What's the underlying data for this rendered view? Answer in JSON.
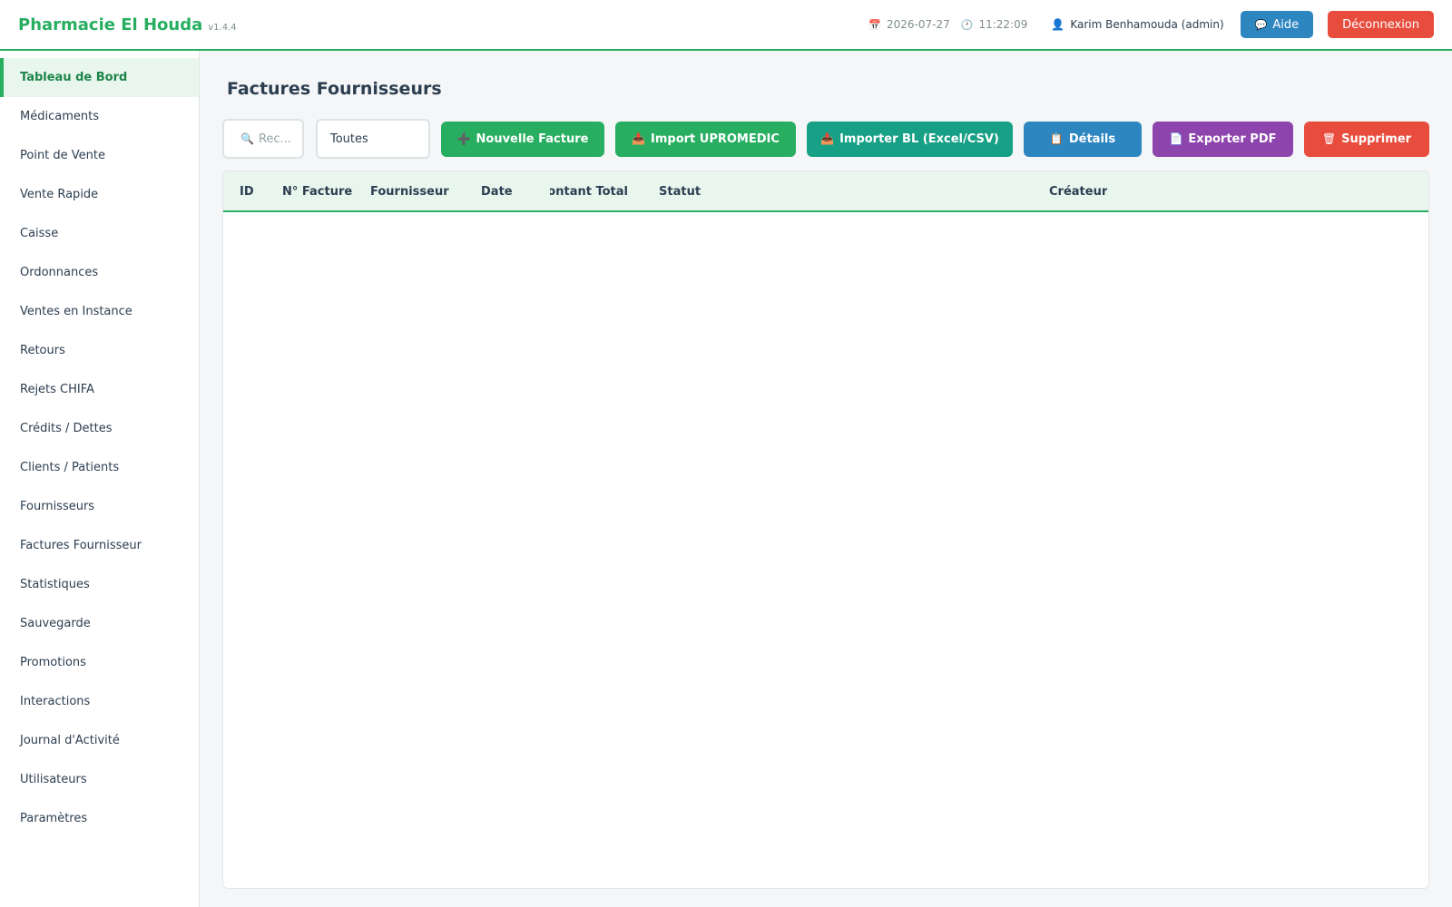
{
  "header": {
    "app_name": "Pharmacie El Houda",
    "version": "v1.4.4",
    "date": "2026-07-27",
    "time": "11:22:09",
    "user": "Karim Benhamouda (admin)",
    "help_label": "Aide",
    "logout_label": "Déconnexion"
  },
  "sidebar": {
    "items": [
      {
        "label": "Tableau de Bord"
      },
      {
        "label": "Médicaments"
      },
      {
        "label": "Point de Vente"
      },
      {
        "label": "Vente Rapide"
      },
      {
        "label": "Caisse"
      },
      {
        "label": "Ordonnances"
      },
      {
        "label": "Ventes en Instance"
      },
      {
        "label": "Retours"
      },
      {
        "label": "Rejets CHIFA"
      },
      {
        "label": "Crédits / Dettes"
      },
      {
        "label": "Clients / Patients"
      },
      {
        "label": "Fournisseurs"
      },
      {
        "label": "Factures Fournisseur"
      },
      {
        "label": "Statistiques"
      },
      {
        "label": "Sauvegarde"
      },
      {
        "label": "Promotions"
      },
      {
        "label": "Interactions"
      },
      {
        "label": "Journal d'Activité"
      },
      {
        "label": "Utilisateurs"
      },
      {
        "label": "Paramètres"
      }
    ],
    "active_index": 0
  },
  "main": {
    "title": "Factures Fournisseurs",
    "search_placeholder": "Rec...",
    "filter_value": "Toutes",
    "buttons": {
      "new_invoice": "Nouvelle Facture",
      "import_upromedic": "Import UPROMEDIC",
      "import_bl": "Importer BL (Excel/CSV)",
      "details": "Détails",
      "export_pdf": "Exporter PDF",
      "delete": "Supprimer"
    },
    "table": {
      "columns": [
        "ID",
        "N° Facture",
        "Fournisseur",
        "Date",
        "Montant Total",
        "Statut",
        "Créateur"
      ],
      "rows": []
    }
  },
  "colors": {
    "accent": "#27ae60",
    "blue": "#2e86c1",
    "teal": "#17a085",
    "purple": "#8e44ad",
    "red": "#e74c3c"
  },
  "icons": {
    "date": "calendar-icon",
    "time": "clock-icon",
    "user": "user-icon",
    "help": "speech-bubble-icon",
    "search": "magnifier-icon",
    "new": "plus-icon",
    "import": "inbox-tray-icon",
    "details": "clipboard-icon",
    "pdf": "document-icon",
    "delete": "wastebasket-icon"
  }
}
